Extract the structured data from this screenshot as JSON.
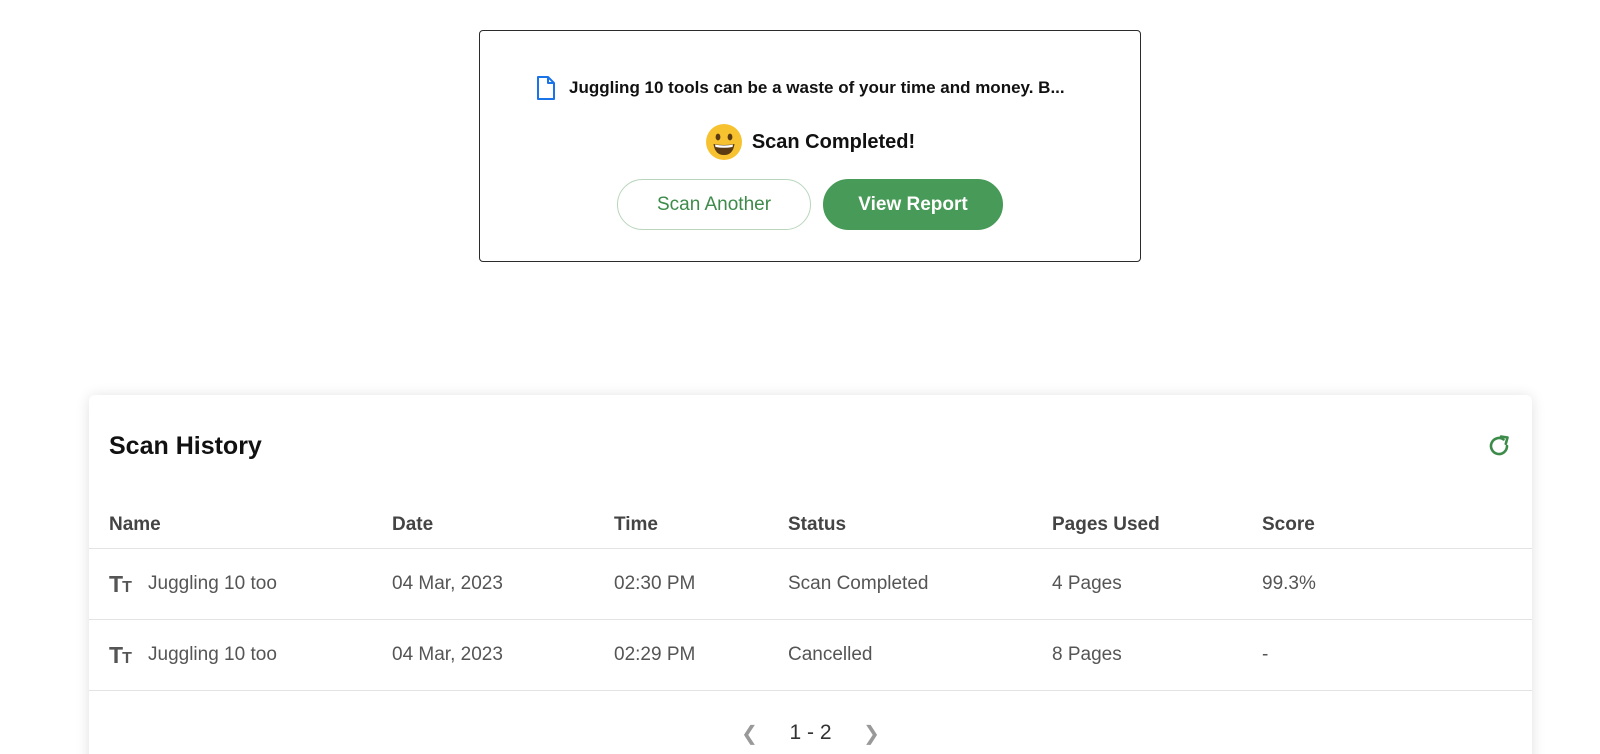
{
  "scan_result": {
    "document_title": "Juggling 10 tools can be a waste of your time and money. B...",
    "status_text": "Scan Completed!",
    "scan_another_label": "Scan Another",
    "view_report_label": "View Report"
  },
  "history": {
    "title": "Scan History",
    "columns": [
      "Name",
      "Date",
      "Time",
      "Status",
      "Pages Used",
      "Score"
    ],
    "rows": [
      {
        "name": "Juggling 10 too",
        "date": "04 Mar, 2023",
        "time": "02:30 PM",
        "status": "Scan Completed",
        "pages": "4 Pages",
        "score": "99.3%"
      },
      {
        "name": "Juggling 10 too",
        "date": "04 Mar, 2023",
        "time": "02:29 PM",
        "status": "Cancelled",
        "pages": "8 Pages",
        "score": "-"
      }
    ],
    "pagination": {
      "range": "1 - 2"
    }
  },
  "icons": {
    "document": "document-icon",
    "status": "smiley-emoji-icon",
    "refresh": "refresh-icon",
    "text_type": "text-type-icon",
    "prev": "chevron-left-icon",
    "next": "chevron-right-icon"
  },
  "colors": {
    "accent_green": "#479a57",
    "outline_green_text": "#3d8b4a",
    "doc_icon_blue": "#1a73e8"
  }
}
